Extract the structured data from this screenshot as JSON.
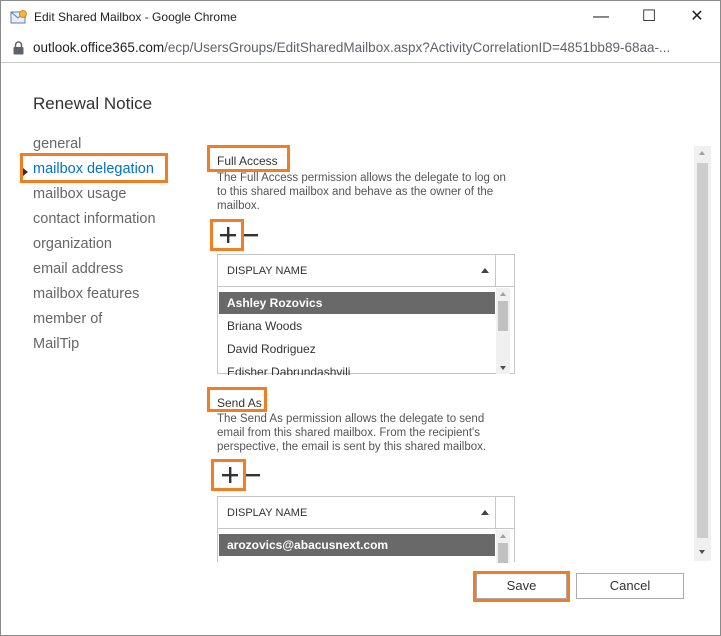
{
  "window": {
    "title": "Edit Shared Mailbox - Google Chrome",
    "minimize": "—",
    "maximize": "☐",
    "close": "✕"
  },
  "address": {
    "host": "outlook.office365.com",
    "path": "/ecp/UsersGroups/EditSharedMailbox.aspx?ActivityCorrelationID=4851bb89-68aa-..."
  },
  "page": {
    "title": "Renewal Notice"
  },
  "nav": {
    "items": [
      {
        "label": "general"
      },
      {
        "label": "mailbox delegation"
      },
      {
        "label": "mailbox usage"
      },
      {
        "label": "contact information"
      },
      {
        "label": "organization"
      },
      {
        "label": "email address"
      },
      {
        "label": "mailbox features"
      },
      {
        "label": "member of"
      },
      {
        "label": "MailTip"
      }
    ],
    "active_index": 1
  },
  "full_access": {
    "title": "Full Access",
    "description": "The Full Access permission allows the delegate to log on to this shared mailbox and behave as the owner of the mailbox.",
    "add_label": "+",
    "remove_label": "−",
    "column_header": "DISPLAY NAME",
    "rows": [
      "Ashley Rozovics",
      "Briana Woods",
      "David Rodriguez",
      "Edisher Dabrundashvili"
    ],
    "selected_index": 0
  },
  "send_as": {
    "title": "Send As",
    "description": "The Send As permission allows the delegate to send email from this shared mailbox. From the recipient's perspective, the email is sent by this shared mailbox.",
    "add_label": "+",
    "remove_label": "−",
    "column_header": "DISPLAY NAME",
    "rows": [
      "arozovics@abacusnext.com"
    ],
    "selected_index": 0
  },
  "actions": {
    "save": "Save",
    "cancel": "Cancel"
  },
  "colors": {
    "accent": "#0072c6",
    "highlight": "#f27d23",
    "selected_row": "#696969"
  }
}
